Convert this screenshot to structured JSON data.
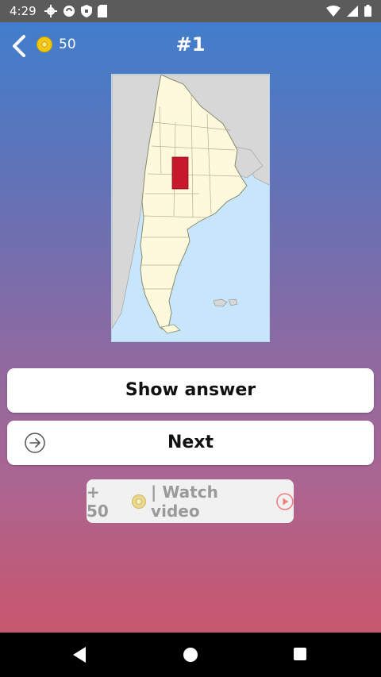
{
  "status_bar": {
    "time": "4:29",
    "left_icons": [
      "gear-icon",
      "sync-icon",
      "shield-icon",
      "sd-card-icon"
    ],
    "right_icons": [
      "wifi-icon",
      "signal-icon",
      "battery-icon"
    ]
  },
  "header": {
    "coins": "50",
    "title": "#1"
  },
  "map": {
    "icon": "argentina-province-map",
    "highlight_color": "#c8182b",
    "land_color": "#fdf9dc",
    "sea_color": "#c8e6fb",
    "neighbor_color": "#d7d7d7"
  },
  "buttons": {
    "show_answer": "Show answer",
    "next": "Next"
  },
  "reward": {
    "prefix": "+ 50",
    "label": "| Watch video"
  },
  "colors": {
    "gradient_top": "#3d7fcf",
    "gradient_bottom": "#c8566b"
  }
}
